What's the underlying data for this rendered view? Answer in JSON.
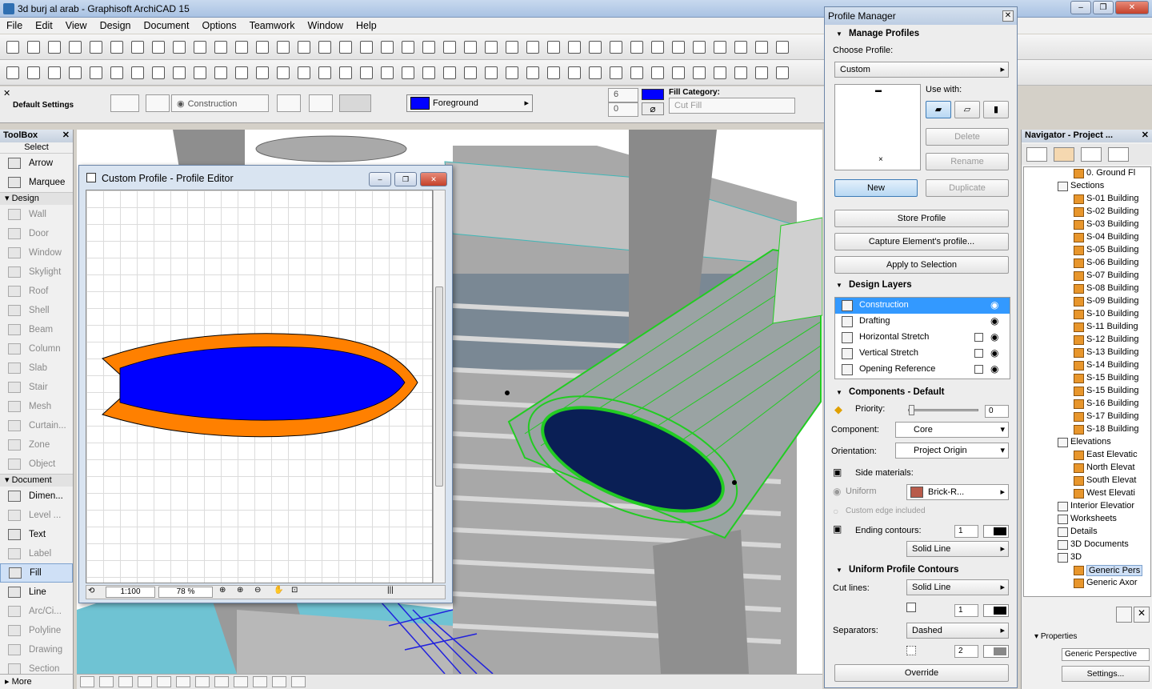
{
  "app": {
    "title": "3d burj al arab - Graphisoft ArchiCAD 15"
  },
  "menu": [
    "File",
    "Edit",
    "View",
    "Design",
    "Document",
    "Options",
    "Teamwork",
    "Window",
    "Help"
  ],
  "infobox": {
    "label": "Default Settings",
    "layer": "Construction",
    "pen": "Foreground",
    "pen_number_1": "6",
    "pen_number_2": "0",
    "fill_category_label": "Fill Category:",
    "fill_category_value": "Cut Fill"
  },
  "toolbox": {
    "title": "ToolBox",
    "select_label": "Select",
    "select_tools": [
      "Arrow",
      "Marquee"
    ],
    "design_label": "Design",
    "design_tools": [
      "Wall",
      "Door",
      "Window",
      "Skylight",
      "Roof",
      "Shell",
      "Beam",
      "Column",
      "Slab",
      "Stair",
      "Mesh",
      "Curtain...",
      "Zone",
      "Object"
    ],
    "document_label": "Document",
    "document_tools": [
      "Dimen...",
      "Level ...",
      "Text",
      "Label",
      "Fill",
      "Line",
      "Arc/Ci...",
      "Polyline",
      "Drawing",
      "Section"
    ],
    "more_label": "More"
  },
  "editor": {
    "title": "Custom Profile - Profile Editor",
    "scale": "1:100",
    "zoom": "78 %"
  },
  "profile_manager": {
    "title": "Profile Manager",
    "manage_profiles": "Manage Profiles",
    "choose_profile_label": "Choose Profile:",
    "choose_profile_value": "Custom",
    "use_with_label": "Use with:",
    "buttons": {
      "delete": "Delete",
      "rename": "Rename",
      "new": "New",
      "duplicate": "Duplicate",
      "store": "Store Profile",
      "capture": "Capture Element's profile...",
      "apply": "Apply to Selection",
      "override": "Override"
    },
    "design_layers_title": "Design Layers",
    "layers": [
      {
        "name": "Construction",
        "checkbox": false
      },
      {
        "name": "Drafting",
        "checkbox": false
      },
      {
        "name": "Horizontal Stretch",
        "checkbox": true
      },
      {
        "name": "Vertical Stretch",
        "checkbox": true
      },
      {
        "name": "Opening Reference",
        "checkbox": true
      }
    ],
    "components_title": "Components - Default",
    "priority_label": "Priority:",
    "priority_value": "0",
    "component_label": "Component:",
    "component_value": "Core",
    "orientation_label": "Orientation:",
    "orientation_value": "Project Origin",
    "side_materials_label": "Side materials:",
    "uniform_label": "Uniform",
    "material_value": "Brick-R...",
    "custom_edge_label": "Custom edge included",
    "ending_contours_label": "Ending contours:",
    "ending_contours_value": "1",
    "ending_line": "Solid Line",
    "uniform_contours_title": "Uniform Profile Contours",
    "cut_lines_label": "Cut lines:",
    "cut_lines_value": "Solid Line",
    "cut_pen": "1",
    "separators_label": "Separators:",
    "separators_value": "Dashed",
    "separator_pen": "2"
  },
  "navigator": {
    "title": "Navigator - Project ...",
    "items": [
      {
        "label": "0. Ground Fl",
        "indent": 3,
        "icon": "story-icon"
      },
      {
        "label": "Sections",
        "indent": 2,
        "icon": "folder-icon"
      },
      {
        "label": "S-01 Building",
        "indent": 3,
        "icon": "section-icon"
      },
      {
        "label": "S-02 Building",
        "indent": 3,
        "icon": "section-icon"
      },
      {
        "label": "S-03 Building",
        "indent": 3,
        "icon": "section-icon"
      },
      {
        "label": "S-04 Building",
        "indent": 3,
        "icon": "section-icon"
      },
      {
        "label": "S-05 Building",
        "indent": 3,
        "icon": "section-icon"
      },
      {
        "label": "S-06 Building",
        "indent": 3,
        "icon": "section-icon"
      },
      {
        "label": "S-07 Building",
        "indent": 3,
        "icon": "section-icon"
      },
      {
        "label": "S-08 Building",
        "indent": 3,
        "icon": "section-icon"
      },
      {
        "label": "S-09 Building",
        "indent": 3,
        "icon": "section-icon"
      },
      {
        "label": "S-10 Building",
        "indent": 3,
        "icon": "section-icon"
      },
      {
        "label": "S-11 Building",
        "indent": 3,
        "icon": "section-icon"
      },
      {
        "label": "S-12 Building",
        "indent": 3,
        "icon": "section-icon"
      },
      {
        "label": "S-13 Building",
        "indent": 3,
        "icon": "section-icon"
      },
      {
        "label": "S-14 Building",
        "indent": 3,
        "icon": "section-icon"
      },
      {
        "label": "S-15 Building",
        "indent": 3,
        "icon": "section-icon"
      },
      {
        "label": "S-15 Building",
        "indent": 3,
        "icon": "section-icon"
      },
      {
        "label": "S-16 Building",
        "indent": 3,
        "icon": "section-icon"
      },
      {
        "label": "S-17 Building",
        "indent": 3,
        "icon": "section-icon"
      },
      {
        "label": "S-18 Building",
        "indent": 3,
        "icon": "section-icon"
      },
      {
        "label": "Elevations",
        "indent": 2,
        "icon": "folder-icon"
      },
      {
        "label": "East Elevatic",
        "indent": 3,
        "icon": "elevation-icon"
      },
      {
        "label": "North Elevat",
        "indent": 3,
        "icon": "elevation-icon"
      },
      {
        "label": "South Elevat",
        "indent": 3,
        "icon": "elevation-icon"
      },
      {
        "label": "West Elevati",
        "indent": 3,
        "icon": "elevation-icon"
      },
      {
        "label": "Interior Elevatior",
        "indent": 2,
        "icon": "folder-icon"
      },
      {
        "label": "Worksheets",
        "indent": 2,
        "icon": "folder-icon"
      },
      {
        "label": "Details",
        "indent": 2,
        "icon": "folder-icon"
      },
      {
        "label": "3D Documents",
        "indent": 2,
        "icon": "folder-icon"
      },
      {
        "label": "3D",
        "indent": 2,
        "icon": "folder-icon"
      },
      {
        "label": "Generic Pers",
        "indent": 3,
        "icon": "camera-icon",
        "selected": true
      },
      {
        "label": "Generic Axor",
        "indent": 3,
        "icon": "camera-icon"
      }
    ],
    "properties_label": "Properties",
    "properties_value": "Generic Perspective",
    "settings_button": "Settings..."
  },
  "colors": {
    "profile_fill": "#0000ff",
    "profile_edge": "#ff8000",
    "highlight": "#3399ff",
    "selection_green": "#22cc22"
  }
}
